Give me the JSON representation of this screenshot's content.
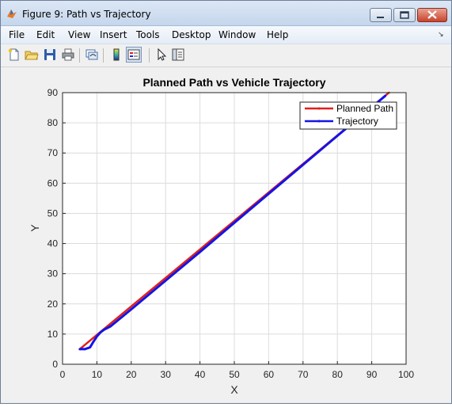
{
  "window": {
    "title": "Figure 9: Path vs Trajectory"
  },
  "menu": {
    "items": [
      "File",
      "Edit",
      "View",
      "Insert",
      "Tools",
      "Desktop",
      "Window",
      "Help"
    ]
  },
  "toolbar": {
    "icons": [
      "new-figure-icon",
      "open-file-icon",
      "save-icon",
      "print-icon",
      "link-plot-icon",
      "colorbar-icon",
      "legend-icon",
      "pointer-icon",
      "property-editor-icon"
    ]
  },
  "chart_data": {
    "type": "line",
    "title": "Planned Path vs Vehicle Trajectory",
    "xlabel": "X",
    "ylabel": "Y",
    "xlim": [
      0,
      100
    ],
    "ylim": [
      0,
      90
    ],
    "xticks": [
      0,
      10,
      20,
      30,
      40,
      50,
      60,
      70,
      80,
      90,
      100
    ],
    "yticks": [
      0,
      10,
      20,
      30,
      40,
      50,
      60,
      70,
      80,
      90
    ],
    "grid": true,
    "legend_location": "top-right",
    "series": [
      {
        "name": "Planned Path",
        "color": "#e0201b",
        "marker": "dot",
        "x": [
          5,
          95
        ],
        "y": [
          5,
          90
        ]
      },
      {
        "name": "Trajectory",
        "color": "#1414e6",
        "marker": "dot",
        "x": [
          5,
          6.5,
          8,
          9,
          10,
          11,
          12,
          14,
          20,
          30,
          40,
          50,
          60,
          70,
          80,
          90,
          94
        ],
        "y": [
          5,
          5,
          5.6,
          7.5,
          9.2,
          10.5,
          11.4,
          12.6,
          18.2,
          27.7,
          37.2,
          46.9,
          56.5,
          66.1,
          75.7,
          85.2,
          89
        ]
      }
    ]
  }
}
